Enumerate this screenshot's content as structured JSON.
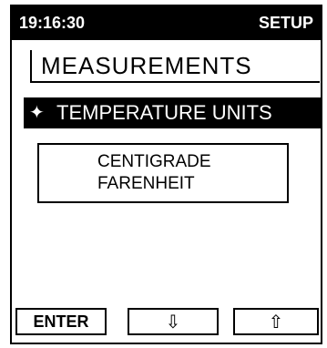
{
  "header": {
    "time": "19:16:30",
    "mode": "SETUP"
  },
  "screen": {
    "title": "MEASUREMENTS",
    "selected_menu": {
      "icon": "diamond-star-icon",
      "label": "TEMPERATURE UNITS"
    },
    "options": [
      {
        "label": "CENTIGRADE"
      },
      {
        "label": "FARENHEIT"
      }
    ]
  },
  "buttons": {
    "enter_label": "ENTER",
    "down_icon": "down-arrow-icon",
    "up_icon": "up-arrow-icon"
  },
  "colors": {
    "foreground": "#000000",
    "background": "#ffffff"
  }
}
